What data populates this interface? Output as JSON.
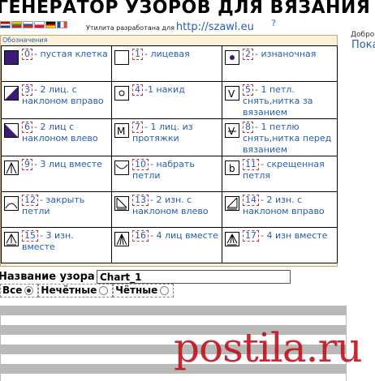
{
  "header": {
    "title": "ГЕНЕРАТОР УЗОРОВ ДЛЯ ВЯЗАНИЯ",
    "credit_text": "Утилита разработана для",
    "credit_link": "http://szawl.eu",
    "help": "?"
  },
  "sidebar": {
    "greeting": "Добро",
    "show_link": "Пока"
  },
  "legend": {
    "title": "Обозначения",
    "rows": [
      [
        {
          "num": "0",
          "text": "- пустая клетка",
          "icon": "filled-square-icon"
        },
        {
          "num": "1",
          "text": "- лицевая",
          "icon": "empty-square-icon"
        },
        {
          "num": "2",
          "text": "- изнаночная",
          "icon": "dot-icon"
        }
      ],
      [
        {
          "num": "3",
          "text": "- 2 лиц. с наклоном вправо",
          "icon": "right-slant-icon"
        },
        {
          "num": "4",
          "text": "-1 накид",
          "icon": "circle-icon"
        },
        {
          "num": "5",
          "text": "- 1 петл. снять,нитка за вязанием",
          "icon": "v-icon"
        }
      ],
      [
        {
          "num": "6",
          "text": "- 2 лиц с наклоном влево",
          "icon": "left-slant-icon"
        },
        {
          "num": "7",
          "text": "- 1 лиц. из протяжки",
          "icon": "m-icon"
        },
        {
          "num": "8",
          "text": "- 1 петлю снять,нитка перед вязанием",
          "icon": "v-bar-icon"
        }
      ],
      [
        {
          "num": "9",
          "text": "- 3 лиц вместе",
          "icon": "three-together-icon"
        },
        {
          "num": "10",
          "text": "- набрать петли",
          "icon": "cast-on-icon"
        },
        {
          "num": "11",
          "text": "- скрещенная петля",
          "icon": "b-icon"
        }
      ],
      [
        {
          "num": "12",
          "text": "- закрыть петли",
          "icon": "bind-off-icon"
        },
        {
          "num": "13",
          "text": "- 2 изн. с наклоном влево",
          "icon": "purl-left-icon"
        },
        {
          "num": "14",
          "text": "- 2 изн. с наклоном вправо",
          "icon": "purl-right-icon"
        }
      ],
      [
        {
          "num": "15",
          "text": "- 3 изн. вместе",
          "icon": "three-purl-icon"
        },
        {
          "num": "16",
          "text": "- 4 лиц вместе",
          "icon": "four-knit-icon"
        },
        {
          "num": "17",
          "text": "- 4 изн вместе",
          "icon": "four-purl-icon"
        }
      ]
    ]
  },
  "pattern": {
    "name_label": "Название узора",
    "name_value": "Chart_1"
  },
  "filters": {
    "all": "Все",
    "odd": "Нечётные",
    "even": "Чётные",
    "selected": "all"
  },
  "watermark": "postila.ru"
}
